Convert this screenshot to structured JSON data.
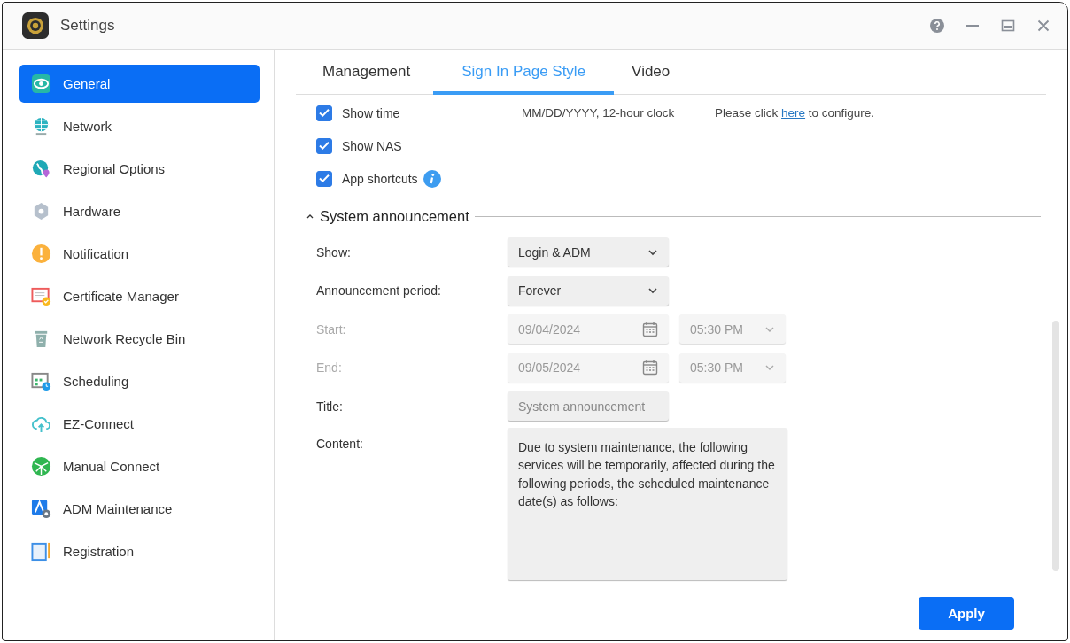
{
  "window": {
    "title": "Settings"
  },
  "sidebar": {
    "items": [
      {
        "label": "General",
        "kind": "general",
        "selected": true
      },
      {
        "label": "Network",
        "kind": "globe",
        "selected": false
      },
      {
        "label": "Regional Options",
        "kind": "region",
        "selected": false
      },
      {
        "label": "Hardware",
        "kind": "hardware",
        "selected": false
      },
      {
        "label": "Notification",
        "kind": "alert",
        "selected": false
      },
      {
        "label": "Certificate Manager",
        "kind": "certificate",
        "selected": false
      },
      {
        "label": "Network Recycle Bin",
        "kind": "bin",
        "selected": false
      },
      {
        "label": "Scheduling",
        "kind": "calendar",
        "selected": false
      },
      {
        "label": "EZ-Connect",
        "kind": "cloud",
        "selected": false
      },
      {
        "label": "Manual Connect",
        "kind": "network",
        "selected": false
      },
      {
        "label": "ADM Maintenance",
        "kind": "maintenance",
        "selected": false
      },
      {
        "label": "Registration",
        "kind": "registration",
        "selected": false
      }
    ]
  },
  "tabs": [
    {
      "label": "Management",
      "selected": false
    },
    {
      "label": "Sign In Page Style",
      "selected": true
    },
    {
      "label": "Video",
      "selected": false
    }
  ],
  "options": [
    {
      "label": "Show time",
      "checked": true,
      "format": "MM/DD/YYYY, 12-hour clock",
      "note": {
        "before": "Please click",
        "link": "here",
        "after": "to configure."
      }
    },
    {
      "label": "Show NAS",
      "checked": true
    },
    {
      "label": "App shortcuts",
      "checked": true,
      "info": true
    }
  ],
  "section": {
    "title": "System announcement",
    "expanded": true,
    "fields": [
      {
        "kind": "select",
        "label": "Show:",
        "value": "Login & ADM",
        "disabled": false
      },
      {
        "kind": "select",
        "label": "Announcement period:",
        "value": "Forever",
        "disabled": false
      },
      {
        "kind": "datetime",
        "label": "Start:",
        "date": "09/04/2024",
        "time": "05:30 PM",
        "disabled": true
      },
      {
        "kind": "datetime",
        "label": "End:",
        "date": "09/05/2024",
        "time": "05:30 PM",
        "disabled": true
      },
      {
        "kind": "text",
        "label": "Title:",
        "placeholder": "System announcement",
        "disabled": false
      },
      {
        "kind": "textarea",
        "label": "Content:",
        "value": "Due to system maintenance, the following services will be temporarily, affected during the following periods, the scheduled maintenance date(s) as follows:",
        "disabled": false
      }
    ]
  },
  "apply_button": "Apply"
}
